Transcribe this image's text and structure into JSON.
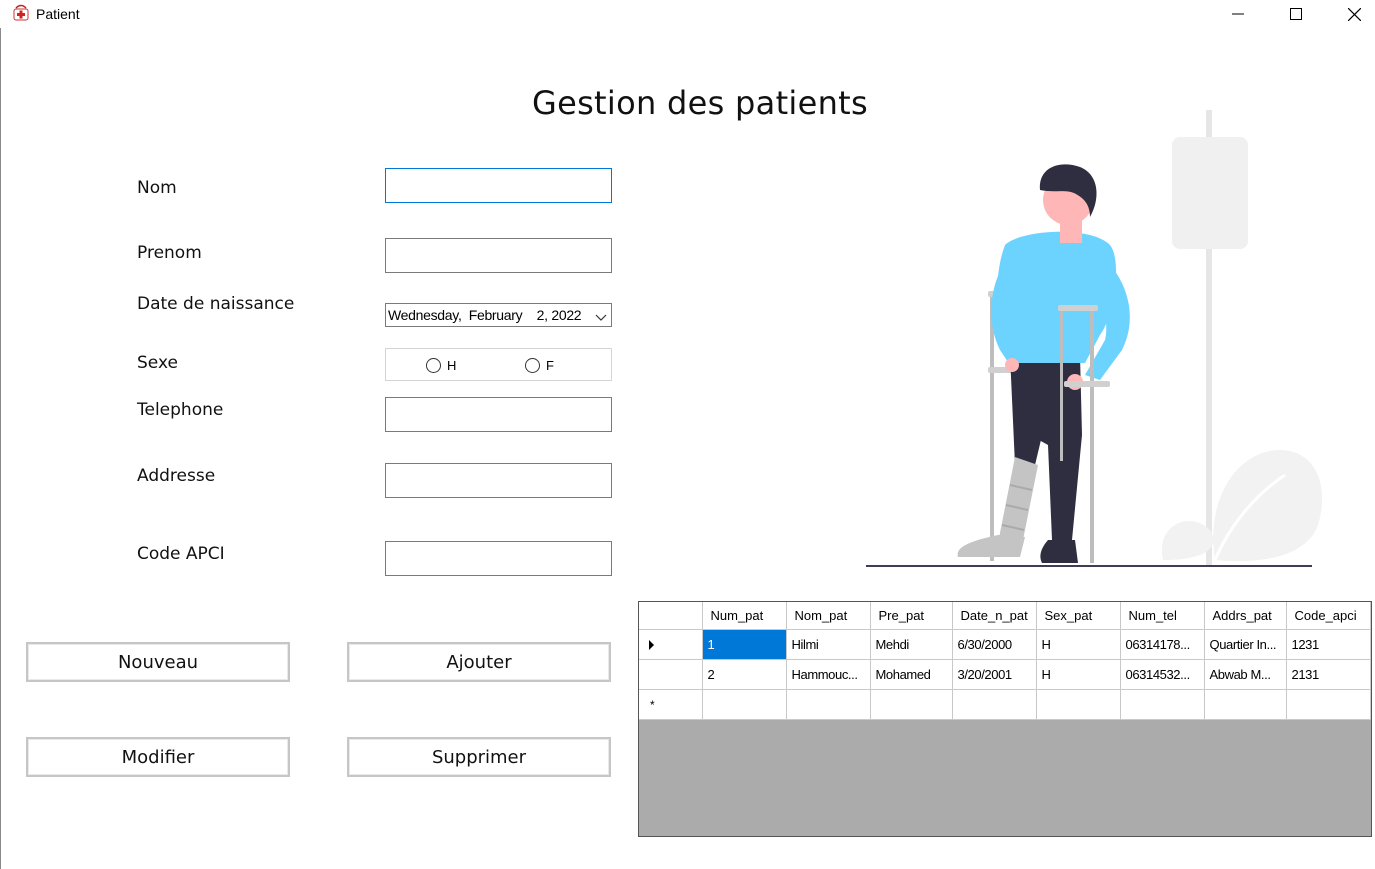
{
  "window": {
    "title": "Patient",
    "icon": "medical-cross-icon",
    "controls": [
      "minimize-icon",
      "maximize-icon",
      "close-icon"
    ]
  },
  "page": {
    "title": "Gestion des patients"
  },
  "form": {
    "nom_label": "Nom",
    "nom_value": "",
    "prenom_label": "Prenom",
    "prenom_value": "",
    "date_label": "Date de naissance",
    "date_value": "Wednesday,  February    2, 2022",
    "sexe_label": "Sexe",
    "sexe_options": [
      "H",
      "F"
    ],
    "sexe_selected": "",
    "telephone_label": "Telephone",
    "telephone_value": "",
    "addresse_label": "Addresse",
    "addresse_value": "",
    "code_label": "Code APCI",
    "code_value": ""
  },
  "buttons": {
    "nouveau": "Nouveau",
    "ajouter": "Ajouter",
    "modifier": "Modifier",
    "supprimer": "Supprimer"
  },
  "grid": {
    "columns": [
      "Num_pat",
      "Nom_pat",
      "Pre_pat",
      "Date_n_pat",
      "Sex_pat",
      "Num_tel",
      "Addrs_pat",
      "Code_apci"
    ],
    "rows": [
      [
        "1",
        "Hilmi",
        "Mehdi",
        "6/30/2000",
        "H",
        "06314178...",
        "Quartier In...",
        "1231"
      ],
      [
        "2",
        "Hammouc...",
        "Mohamed",
        "3/20/2001",
        "H",
        "06314532...",
        "Abwab M...",
        "2131"
      ]
    ],
    "new_row_marker": "*"
  },
  "colors": {
    "accent": "#0078d7",
    "shirt": "#6cd3ff",
    "pants": "#2f2e41",
    "skin": "#ffb6b6",
    "cast": "#c4c4c4",
    "iv_pole": "#e6e6e6"
  }
}
